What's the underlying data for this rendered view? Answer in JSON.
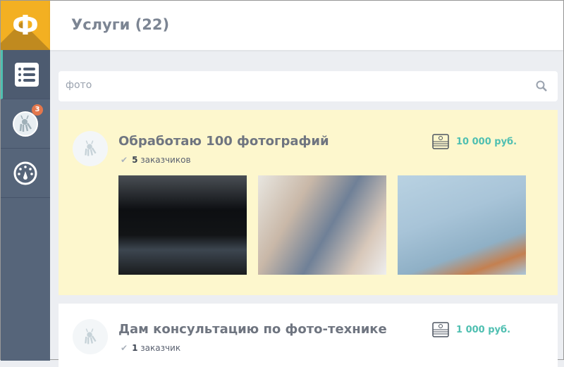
{
  "logo": "Ф",
  "header": {
    "title": "Услуги (22)"
  },
  "sidebar": {
    "badge": "3"
  },
  "search": {
    "value": "фото"
  },
  "services": [
    {
      "title": "Обработаю 100 фотографий",
      "count": "5",
      "count_label": "заказчиков",
      "price": "10 000 руб."
    },
    {
      "title": "Дам консультацию по фото-технике",
      "count": "1",
      "count_label": "заказчик",
      "price": "1 000 руб."
    }
  ]
}
